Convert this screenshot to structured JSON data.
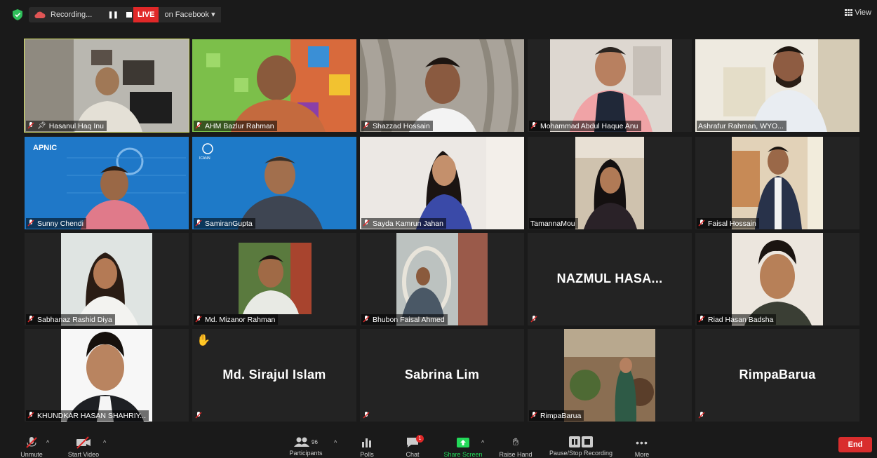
{
  "top_bar": {
    "recording_label": "Recording...",
    "live_label": "LIVE",
    "live_target": "on Facebook",
    "view_label": "View"
  },
  "participants": [
    {
      "name": "Hasanul Haq Inu",
      "active": true,
      "pinned": true
    },
    {
      "name": "AHM Bazlur Rahman"
    },
    {
      "name": "Shazzad Hossain"
    },
    {
      "name": "Mohammad Abdul Haque Anu"
    },
    {
      "name": "Ashrafur Rahman, WYO..."
    },
    {
      "name": "Sunny Chendi",
      "banner": "APNIC"
    },
    {
      "name": "SamiranGupta",
      "banner": "ICANN"
    },
    {
      "name": "Sayda Kamrun Jahan"
    },
    {
      "name": "TamannaMou"
    },
    {
      "name": "Faisal Hossain"
    },
    {
      "name": "Sabhanaz Rashid Diya"
    },
    {
      "name": "Md. Mizanor Rahman"
    },
    {
      "name": "Bhubon Faisal Ahmed"
    },
    {
      "display_name": "NAZMUL HASA..."
    },
    {
      "name": "Riad Hasan Badsha"
    },
    {
      "name": "KHUNDKAR HASAN SHAHRIY..."
    },
    {
      "display_name": "Md. Sirajul Islam",
      "hand_raised": true
    },
    {
      "display_name": "Sabrina Lim"
    },
    {
      "name": "RimpaBarua"
    },
    {
      "display_name": "RimpaBarua"
    }
  ],
  "toolbar": {
    "unmute": "Unmute",
    "start_video": "Start Video",
    "participants_label": "Participants",
    "participants_count": "96",
    "polls": "Polls",
    "chat": "Chat",
    "chat_badge": "1",
    "share_screen": "Share Screen",
    "raise_hand": "Raise Hand",
    "pause_recording": "Pause/Stop Recording",
    "more": "More",
    "end": "End"
  },
  "colors": {
    "active_speaker": "#d9e36a",
    "live": "#e02828",
    "end": "#d92d2d",
    "share": "#23d959"
  }
}
